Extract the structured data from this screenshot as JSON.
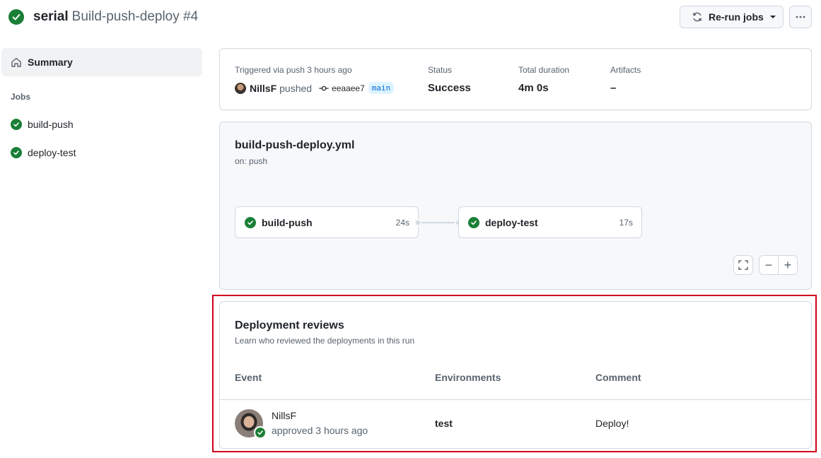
{
  "header": {
    "repo": "serial",
    "workflow_run": "Build-push-deploy #4",
    "rerun_label": "Re-run jobs"
  },
  "sidebar": {
    "summary_label": "Summary",
    "jobs_heading": "Jobs",
    "jobs": [
      {
        "label": "build-push",
        "status": "success"
      },
      {
        "label": "deploy-test",
        "status": "success"
      }
    ]
  },
  "summary": {
    "trigger_text": "Triggered via push 3 hours ago",
    "actor": "NillsF",
    "verb": "pushed",
    "commit": "eeaaee7",
    "branch": "main",
    "status_label": "Status",
    "status_value": "Success",
    "duration_label": "Total duration",
    "duration_value": "4m 0s",
    "artifacts_label": "Artifacts",
    "artifacts_value": "–"
  },
  "graph": {
    "workflow_file": "build-push-deploy.yml",
    "trigger": "on: push",
    "jobs": [
      {
        "name": "build-push",
        "duration": "24s"
      },
      {
        "name": "deploy-test",
        "duration": "17s"
      }
    ],
    "zoom_out": "−",
    "zoom_in": "+"
  },
  "reviews": {
    "title": "Deployment reviews",
    "subtitle": "Learn who reviewed the deployments in this run",
    "columns": [
      "Event",
      "Environments",
      "Comment"
    ],
    "rows": [
      {
        "user": "NillsF",
        "action": "approved 3 hours ago",
        "environment": "test",
        "comment": "Deploy!"
      }
    ]
  },
  "colors": {
    "success": "#1a7f37",
    "highlight_border": "#d0021b",
    "accent_blue": "#0969da"
  }
}
